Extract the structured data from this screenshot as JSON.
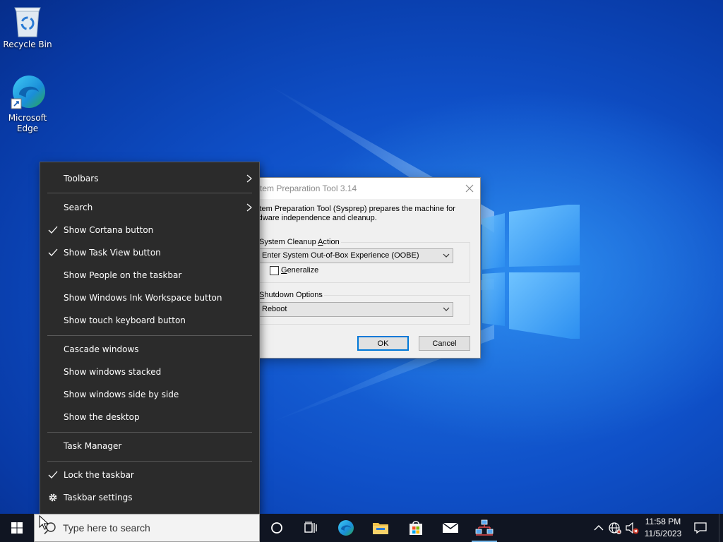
{
  "desktop": {
    "icons": [
      {
        "label": "Recycle Bin",
        "icon": "recycle-bin-icon"
      },
      {
        "label": "Microsoft Edge",
        "icon": "edge-icon"
      }
    ]
  },
  "dialog": {
    "title": "stem Preparation Tool 3.14",
    "description": "stem Preparation Tool (Sysprep) prepares the machine for rdware independence and cleanup.",
    "cleanup_group": {
      "label_prefix": "System Cleanup ",
      "label_accel": "A",
      "label_suffix": "ction"
    },
    "cleanup_combo": {
      "value": "Enter System Out-of-Box Experience (OOBE)"
    },
    "generalize": {
      "label_accel": "G",
      "label_rest": "eneralize",
      "checked": false
    },
    "shutdown_group": {
      "label_prefix": "",
      "label_accel": "S",
      "label_suffix": "hutdown Options"
    },
    "shutdown_combo": {
      "value": "Reboot"
    },
    "ok_label": "OK",
    "cancel_label": "Cancel"
  },
  "context_menu": {
    "items": [
      {
        "label": "Toolbars",
        "checked": false,
        "submenu": true
      },
      {
        "label": "Search",
        "checked": false,
        "submenu": true
      },
      {
        "label": "Show Cortana button",
        "checked": true,
        "submenu": false
      },
      {
        "label": "Show Task View button",
        "checked": true,
        "submenu": false
      },
      {
        "label": "Show People on the taskbar",
        "checked": false,
        "submenu": false
      },
      {
        "label": "Show Windows Ink Workspace button",
        "checked": false,
        "submenu": false
      },
      {
        "label": "Show touch keyboard button",
        "checked": false,
        "submenu": false
      },
      {
        "label": "Cascade windows",
        "checked": false,
        "submenu": false
      },
      {
        "label": "Show windows stacked",
        "checked": false,
        "submenu": false
      },
      {
        "label": "Show windows side by side",
        "checked": false,
        "submenu": false
      },
      {
        "label": "Show the desktop",
        "checked": false,
        "submenu": false
      },
      {
        "label": "Task Manager",
        "checked": false,
        "submenu": false
      },
      {
        "label": "Lock the taskbar",
        "checked": true,
        "submenu": false
      },
      {
        "label": "Taskbar settings",
        "checked": false,
        "submenu": false,
        "icon": "gear-icon"
      }
    ]
  },
  "taskbar": {
    "search_placeholder": "Type here to search",
    "pinned": [
      "cortana-icon",
      "task-view-icon",
      "edge-icon",
      "file-explorer-icon",
      "store-icon",
      "mail-icon",
      "network-app-icon"
    ],
    "clock": {
      "time": "11:58 PM",
      "date": "11/5/2023"
    },
    "accent": "#76b9ed"
  }
}
